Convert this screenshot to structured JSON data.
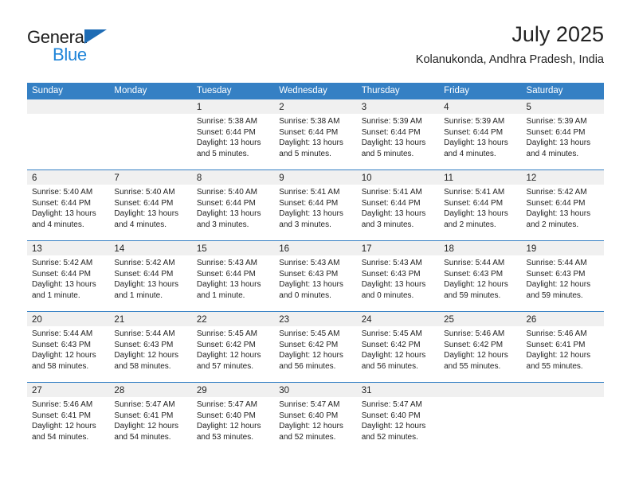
{
  "brand": {
    "name_part1": "General",
    "name_part2": "Blue",
    "triangle_color": "#1e6cb5",
    "blue_color": "#1e84d8"
  },
  "header": {
    "month_title": "July 2025",
    "location": "Kolanukonda, Andhra Pradesh, India"
  },
  "theme": {
    "header_blue": "#3580c4",
    "daynum_band": "#f0f0f0",
    "text": "#222222"
  },
  "weekdays": [
    "Sunday",
    "Monday",
    "Tuesday",
    "Wednesday",
    "Thursday",
    "Friday",
    "Saturday"
  ],
  "weeks": [
    [
      {
        "day": "",
        "sunrise": "",
        "sunset": "",
        "daylight_1": "",
        "daylight_2": ""
      },
      {
        "day": "",
        "sunrise": "",
        "sunset": "",
        "daylight_1": "",
        "daylight_2": ""
      },
      {
        "day": "1",
        "sunrise": "Sunrise: 5:38 AM",
        "sunset": "Sunset: 6:44 PM",
        "daylight_1": "Daylight: 13 hours",
        "daylight_2": "and 5 minutes."
      },
      {
        "day": "2",
        "sunrise": "Sunrise: 5:38 AM",
        "sunset": "Sunset: 6:44 PM",
        "daylight_1": "Daylight: 13 hours",
        "daylight_2": "and 5 minutes."
      },
      {
        "day": "3",
        "sunrise": "Sunrise: 5:39 AM",
        "sunset": "Sunset: 6:44 PM",
        "daylight_1": "Daylight: 13 hours",
        "daylight_2": "and 5 minutes."
      },
      {
        "day": "4",
        "sunrise": "Sunrise: 5:39 AM",
        "sunset": "Sunset: 6:44 PM",
        "daylight_1": "Daylight: 13 hours",
        "daylight_2": "and 4 minutes."
      },
      {
        "day": "5",
        "sunrise": "Sunrise: 5:39 AM",
        "sunset": "Sunset: 6:44 PM",
        "daylight_1": "Daylight: 13 hours",
        "daylight_2": "and 4 minutes."
      }
    ],
    [
      {
        "day": "6",
        "sunrise": "Sunrise: 5:40 AM",
        "sunset": "Sunset: 6:44 PM",
        "daylight_1": "Daylight: 13 hours",
        "daylight_2": "and 4 minutes."
      },
      {
        "day": "7",
        "sunrise": "Sunrise: 5:40 AM",
        "sunset": "Sunset: 6:44 PM",
        "daylight_1": "Daylight: 13 hours",
        "daylight_2": "and 4 minutes."
      },
      {
        "day": "8",
        "sunrise": "Sunrise: 5:40 AM",
        "sunset": "Sunset: 6:44 PM",
        "daylight_1": "Daylight: 13 hours",
        "daylight_2": "and 3 minutes."
      },
      {
        "day": "9",
        "sunrise": "Sunrise: 5:41 AM",
        "sunset": "Sunset: 6:44 PM",
        "daylight_1": "Daylight: 13 hours",
        "daylight_2": "and 3 minutes."
      },
      {
        "day": "10",
        "sunrise": "Sunrise: 5:41 AM",
        "sunset": "Sunset: 6:44 PM",
        "daylight_1": "Daylight: 13 hours",
        "daylight_2": "and 3 minutes."
      },
      {
        "day": "11",
        "sunrise": "Sunrise: 5:41 AM",
        "sunset": "Sunset: 6:44 PM",
        "daylight_1": "Daylight: 13 hours",
        "daylight_2": "and 2 minutes."
      },
      {
        "day": "12",
        "sunrise": "Sunrise: 5:42 AM",
        "sunset": "Sunset: 6:44 PM",
        "daylight_1": "Daylight: 13 hours",
        "daylight_2": "and 2 minutes."
      }
    ],
    [
      {
        "day": "13",
        "sunrise": "Sunrise: 5:42 AM",
        "sunset": "Sunset: 6:44 PM",
        "daylight_1": "Daylight: 13 hours",
        "daylight_2": "and 1 minute."
      },
      {
        "day": "14",
        "sunrise": "Sunrise: 5:42 AM",
        "sunset": "Sunset: 6:44 PM",
        "daylight_1": "Daylight: 13 hours",
        "daylight_2": "and 1 minute."
      },
      {
        "day": "15",
        "sunrise": "Sunrise: 5:43 AM",
        "sunset": "Sunset: 6:44 PM",
        "daylight_1": "Daylight: 13 hours",
        "daylight_2": "and 1 minute."
      },
      {
        "day": "16",
        "sunrise": "Sunrise: 5:43 AM",
        "sunset": "Sunset: 6:43 PM",
        "daylight_1": "Daylight: 13 hours",
        "daylight_2": "and 0 minutes."
      },
      {
        "day": "17",
        "sunrise": "Sunrise: 5:43 AM",
        "sunset": "Sunset: 6:43 PM",
        "daylight_1": "Daylight: 13 hours",
        "daylight_2": "and 0 minutes."
      },
      {
        "day": "18",
        "sunrise": "Sunrise: 5:44 AM",
        "sunset": "Sunset: 6:43 PM",
        "daylight_1": "Daylight: 12 hours",
        "daylight_2": "and 59 minutes."
      },
      {
        "day": "19",
        "sunrise": "Sunrise: 5:44 AM",
        "sunset": "Sunset: 6:43 PM",
        "daylight_1": "Daylight: 12 hours",
        "daylight_2": "and 59 minutes."
      }
    ],
    [
      {
        "day": "20",
        "sunrise": "Sunrise: 5:44 AM",
        "sunset": "Sunset: 6:43 PM",
        "daylight_1": "Daylight: 12 hours",
        "daylight_2": "and 58 minutes."
      },
      {
        "day": "21",
        "sunrise": "Sunrise: 5:44 AM",
        "sunset": "Sunset: 6:43 PM",
        "daylight_1": "Daylight: 12 hours",
        "daylight_2": "and 58 minutes."
      },
      {
        "day": "22",
        "sunrise": "Sunrise: 5:45 AM",
        "sunset": "Sunset: 6:42 PM",
        "daylight_1": "Daylight: 12 hours",
        "daylight_2": "and 57 minutes."
      },
      {
        "day": "23",
        "sunrise": "Sunrise: 5:45 AM",
        "sunset": "Sunset: 6:42 PM",
        "daylight_1": "Daylight: 12 hours",
        "daylight_2": "and 56 minutes."
      },
      {
        "day": "24",
        "sunrise": "Sunrise: 5:45 AM",
        "sunset": "Sunset: 6:42 PM",
        "daylight_1": "Daylight: 12 hours",
        "daylight_2": "and 56 minutes."
      },
      {
        "day": "25",
        "sunrise": "Sunrise: 5:46 AM",
        "sunset": "Sunset: 6:42 PM",
        "daylight_1": "Daylight: 12 hours",
        "daylight_2": "and 55 minutes."
      },
      {
        "day": "26",
        "sunrise": "Sunrise: 5:46 AM",
        "sunset": "Sunset: 6:41 PM",
        "daylight_1": "Daylight: 12 hours",
        "daylight_2": "and 55 minutes."
      }
    ],
    [
      {
        "day": "27",
        "sunrise": "Sunrise: 5:46 AM",
        "sunset": "Sunset: 6:41 PM",
        "daylight_1": "Daylight: 12 hours",
        "daylight_2": "and 54 minutes."
      },
      {
        "day": "28",
        "sunrise": "Sunrise: 5:47 AM",
        "sunset": "Sunset: 6:41 PM",
        "daylight_1": "Daylight: 12 hours",
        "daylight_2": "and 54 minutes."
      },
      {
        "day": "29",
        "sunrise": "Sunrise: 5:47 AM",
        "sunset": "Sunset: 6:40 PM",
        "daylight_1": "Daylight: 12 hours",
        "daylight_2": "and 53 minutes."
      },
      {
        "day": "30",
        "sunrise": "Sunrise: 5:47 AM",
        "sunset": "Sunset: 6:40 PM",
        "daylight_1": "Daylight: 12 hours",
        "daylight_2": "and 52 minutes."
      },
      {
        "day": "31",
        "sunrise": "Sunrise: 5:47 AM",
        "sunset": "Sunset: 6:40 PM",
        "daylight_1": "Daylight: 12 hours",
        "daylight_2": "and 52 minutes."
      },
      {
        "day": "",
        "sunrise": "",
        "sunset": "",
        "daylight_1": "",
        "daylight_2": ""
      },
      {
        "day": "",
        "sunrise": "",
        "sunset": "",
        "daylight_1": "",
        "daylight_2": ""
      }
    ]
  ]
}
